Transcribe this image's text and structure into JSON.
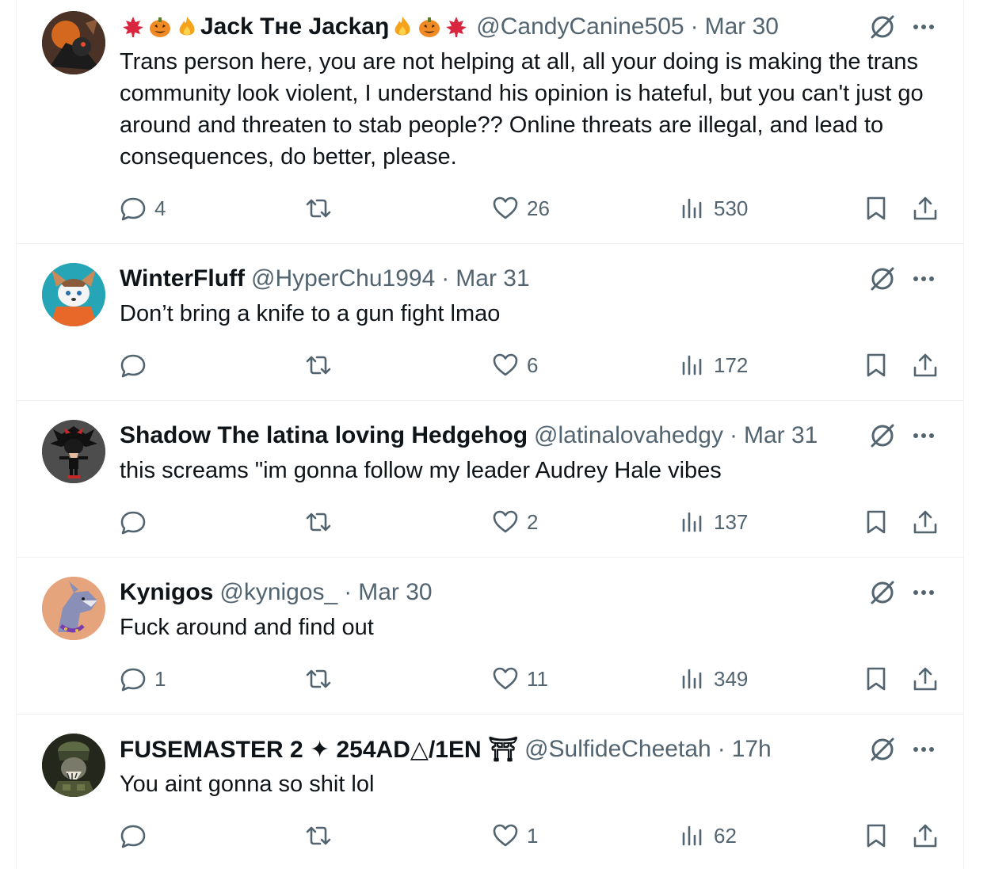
{
  "tweets": [
    {
      "name": "Jack Tнe Jackaŋ",
      "handle": "@CandyCanine505",
      "sep": "·",
      "time": "Mar 30",
      "text": "Trans person here, you are not helping at all, all your doing is making the trans community look violent, I understand his opinion is hateful, but you can't just go around and threaten to stab people?? Online threats are illegal, and lead to consequences, do better, please.",
      "replies": "4",
      "reposts": "",
      "likes": "26",
      "views": "530"
    },
    {
      "name": "WinterFluff",
      "handle": "@HyperChu1994",
      "sep": "·",
      "time": "Mar 31",
      "text": "Don’t bring a knife to a gun fight lmao",
      "replies": "",
      "reposts": "",
      "likes": "6",
      "views": "172"
    },
    {
      "name": "Shadow The latina loving Hedgehog",
      "handle": "@latinalovahedgy",
      "sep": "·",
      "time": "Mar 31",
      "text": "this screams \"im gonna follow my leader Audrey Hale vibes",
      "replies": "",
      "reposts": "",
      "likes": "2",
      "views": "137"
    },
    {
      "name": "Kynigos",
      "handle": "@kynigos_",
      "sep": "·",
      "time": "Mar 30",
      "text": "Fuck around and find out",
      "replies": "1",
      "reposts": "",
      "likes": "11",
      "views": "349"
    },
    {
      "name": "FUSEMASTER 2 ✦ 254AD△/1EN ⛩",
      "handle": "@SulfideCheetah",
      "sep": "·",
      "time": "17h",
      "text": "You aint gonna so shit lol",
      "replies": "",
      "reposts": "",
      "likes": "1",
      "views": "62"
    }
  ],
  "icons": {
    "reply": "reply-icon",
    "repost": "repost-icon",
    "like": "heart-icon",
    "views": "views-icon",
    "bookmark": "bookmark-icon",
    "share": "share-icon",
    "grok": "grok-icon",
    "more": "more-icon"
  },
  "colors": {
    "text": "#0f1419",
    "secondary": "#536471",
    "border": "#eff3f4",
    "maple": "#d7263d",
    "pumpkin": "#f08a24",
    "fire": "#f7a21b"
  }
}
